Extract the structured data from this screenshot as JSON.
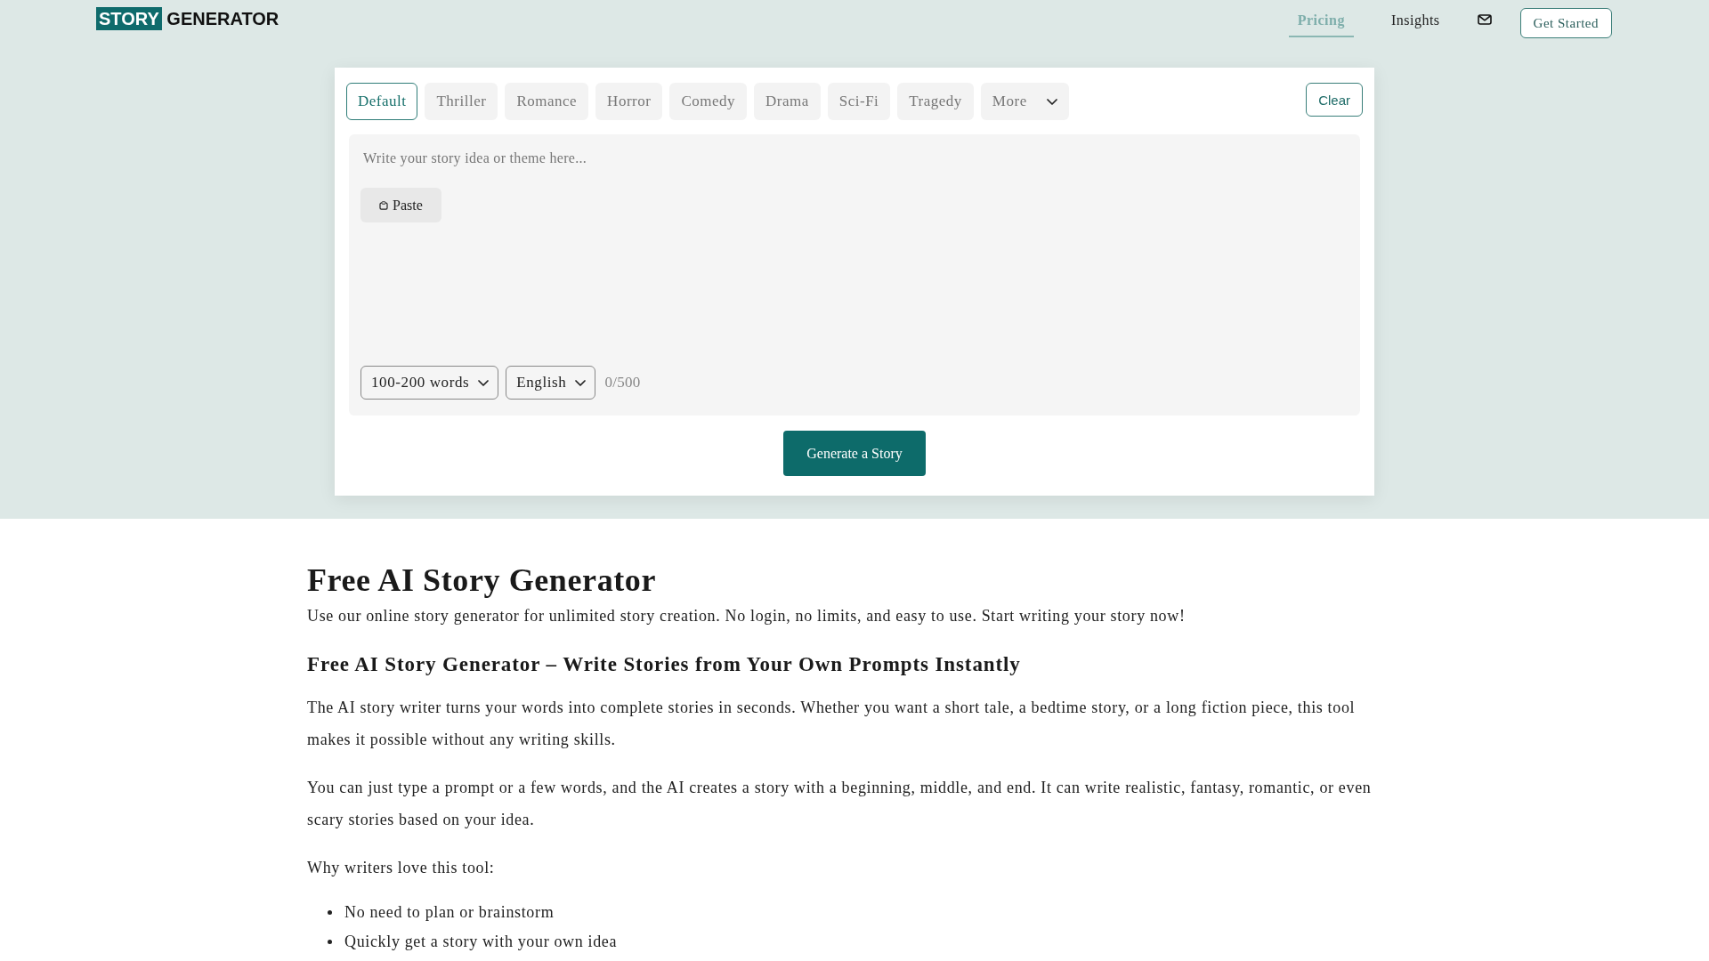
{
  "header": {
    "logo": {
      "highlight": "STORY",
      "text": "GENERATOR"
    },
    "nav": [
      {
        "label": "Pricing",
        "selected": true
      },
      {
        "label": "Insights",
        "selected": false
      }
    ],
    "cta": "Get Started"
  },
  "generator": {
    "tabs": [
      {
        "label": "Default",
        "selected": true
      },
      {
        "label": "Thriller",
        "selected": false
      },
      {
        "label": "Romance",
        "selected": false
      },
      {
        "label": "Horror",
        "selected": false
      },
      {
        "label": "Comedy",
        "selected": false
      },
      {
        "label": "Drama",
        "selected": false
      },
      {
        "label": "Sci-Fi",
        "selected": false
      },
      {
        "label": "Tragedy",
        "selected": false
      }
    ],
    "more": "More",
    "clear": "Clear",
    "prompt": {
      "placeholder": "Write your story idea or theme here...",
      "paste": "Paste"
    },
    "length": {
      "value": "100-200 words"
    },
    "language": {
      "value": "English"
    },
    "counter": "0/500",
    "generate": "Generate a Story"
  },
  "article": {
    "title": "Free AI Story Generator",
    "intro": "Use our online story generator for unlimited story creation. No login, no limits, and easy to use. Start writing your story now!",
    "heading": "Free AI Story Generator – Write Stories from Your Own Prompts Instantly",
    "paragraphs": [
      "The AI story writer turns your words into complete stories in seconds. Whether you want a short tale, a bedtime story, or a long fiction piece, this tool makes it possible without any writing skills.",
      "You can just type a prompt or a few words, and the AI creates a story with a beginning, middle, and end. It can write realistic, fantasy, romantic, or even scary stories based on your idea."
    ],
    "list_intro": "Why writers love this tool:",
    "list_items": [
      "No need to plan or brainstorm",
      "Quickly get a story with your own idea"
    ]
  }
}
